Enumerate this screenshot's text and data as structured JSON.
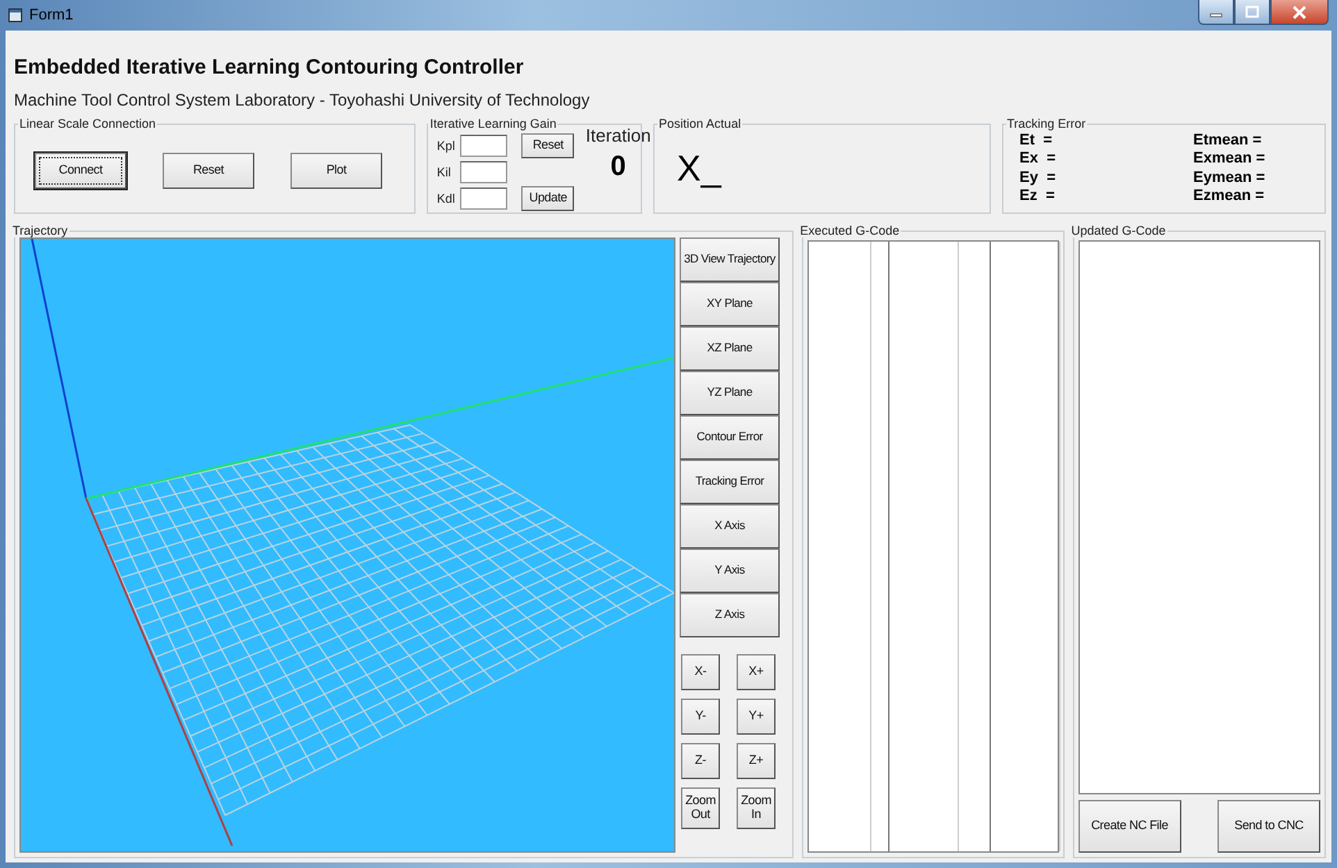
{
  "window": {
    "title": "Form1"
  },
  "header": {
    "title": "Embedded Iterative Learning Contouring Controller",
    "subtitle": "Machine Tool Control System Laboratory - Toyohashi University of Technology"
  },
  "linear_scale": {
    "label": "Linear Scale Connection",
    "buttons": [
      {
        "label": "Connect",
        "focused": true
      },
      {
        "label": "Reset",
        "focused": false
      },
      {
        "label": "Plot",
        "focused": false
      }
    ]
  },
  "gain": {
    "label": "Iterative Learning Gain",
    "fields": [
      {
        "label": "Kpl"
      },
      {
        "label": "Kil"
      },
      {
        "label": "Kdl"
      }
    ],
    "buttons": [
      "Reset",
      "Update"
    ],
    "iteration_label": "Iteration",
    "iteration_value": "0"
  },
  "position": {
    "label": "Position Actual",
    "value": "X_"
  },
  "tracking_error": {
    "label": "Tracking Error",
    "rows": [
      {
        "left": "Et  =",
        "right": "Etmean ="
      },
      {
        "left": "Ex  =",
        "right": "Exmean ="
      },
      {
        "left": "Ey  =",
        "right": "Eymean ="
      },
      {
        "left": "Ez  =",
        "right": "Ezmean ="
      }
    ]
  },
  "trajectory": {
    "label": "Trajectory",
    "view_buttons": [
      "3D View Trajectory",
      "XY Plane",
      "XZ Plane",
      "YZ Plane",
      "Contour Error",
      "Tracking Error",
      "X Axis",
      "Y Axis",
      "Z Axis"
    ],
    "jog_buttons": [
      "X-",
      "X+",
      "Y-",
      "Y+",
      "Z-",
      "Z+",
      "Zoom Out",
      "Zoom In"
    ]
  },
  "executed": {
    "label": "Executed G-Code"
  },
  "updated": {
    "label": "Updated G-Code",
    "buttons": [
      "Create NC File",
      "Send to CNC"
    ]
  }
}
